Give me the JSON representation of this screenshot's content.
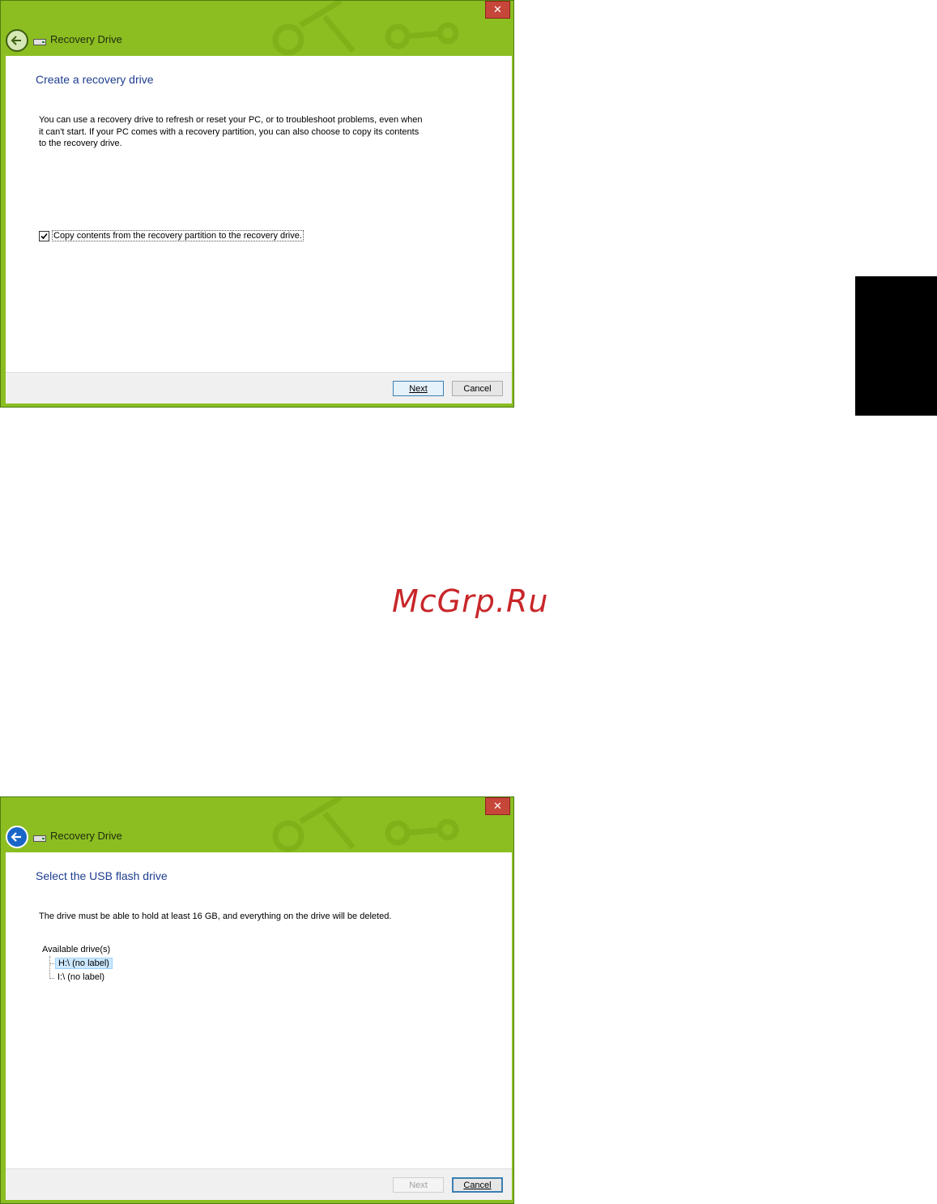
{
  "window1": {
    "title": "Recovery Drive",
    "close_glyph": "✕",
    "heading": "Create a recovery drive",
    "description_lines": [
      "You can use a recovery drive to refresh or reset your PC, or to troubleshoot problems, even when",
      "it can't start. If your PC comes with a recovery partition, you can also choose to copy its contents",
      "to the recovery drive."
    ],
    "checkbox_label": "Copy contents from the recovery partition to the recovery drive.",
    "checkbox_checked": true,
    "next_label": "Next",
    "cancel_label": "Cancel"
  },
  "window2": {
    "title": "Recovery Drive",
    "close_glyph": "✕",
    "heading": "Select the USB flash drive",
    "description": "The drive must be able to hold at least 16 GB, and everything on the drive will be deleted.",
    "tree_root": "Available drive(s)",
    "drives": [
      "H:\\ (no label)",
      "I:\\ (no label)"
    ],
    "selected_drive": "H:\\ (no label)",
    "next_label": "Next",
    "cancel_label": "Cancel"
  },
  "watermark": "McGrp.Ru",
  "colors": {
    "titlebar_green": "#8cbe22",
    "heading_blue": "#1e3d8f",
    "close_red": "#c7463a",
    "watermark_red": "#c8262a"
  },
  "icons": {
    "back": "back-arrow-icon",
    "drive": "usb-drive-icon",
    "close": "close-icon",
    "check": "checkmark-icon"
  }
}
